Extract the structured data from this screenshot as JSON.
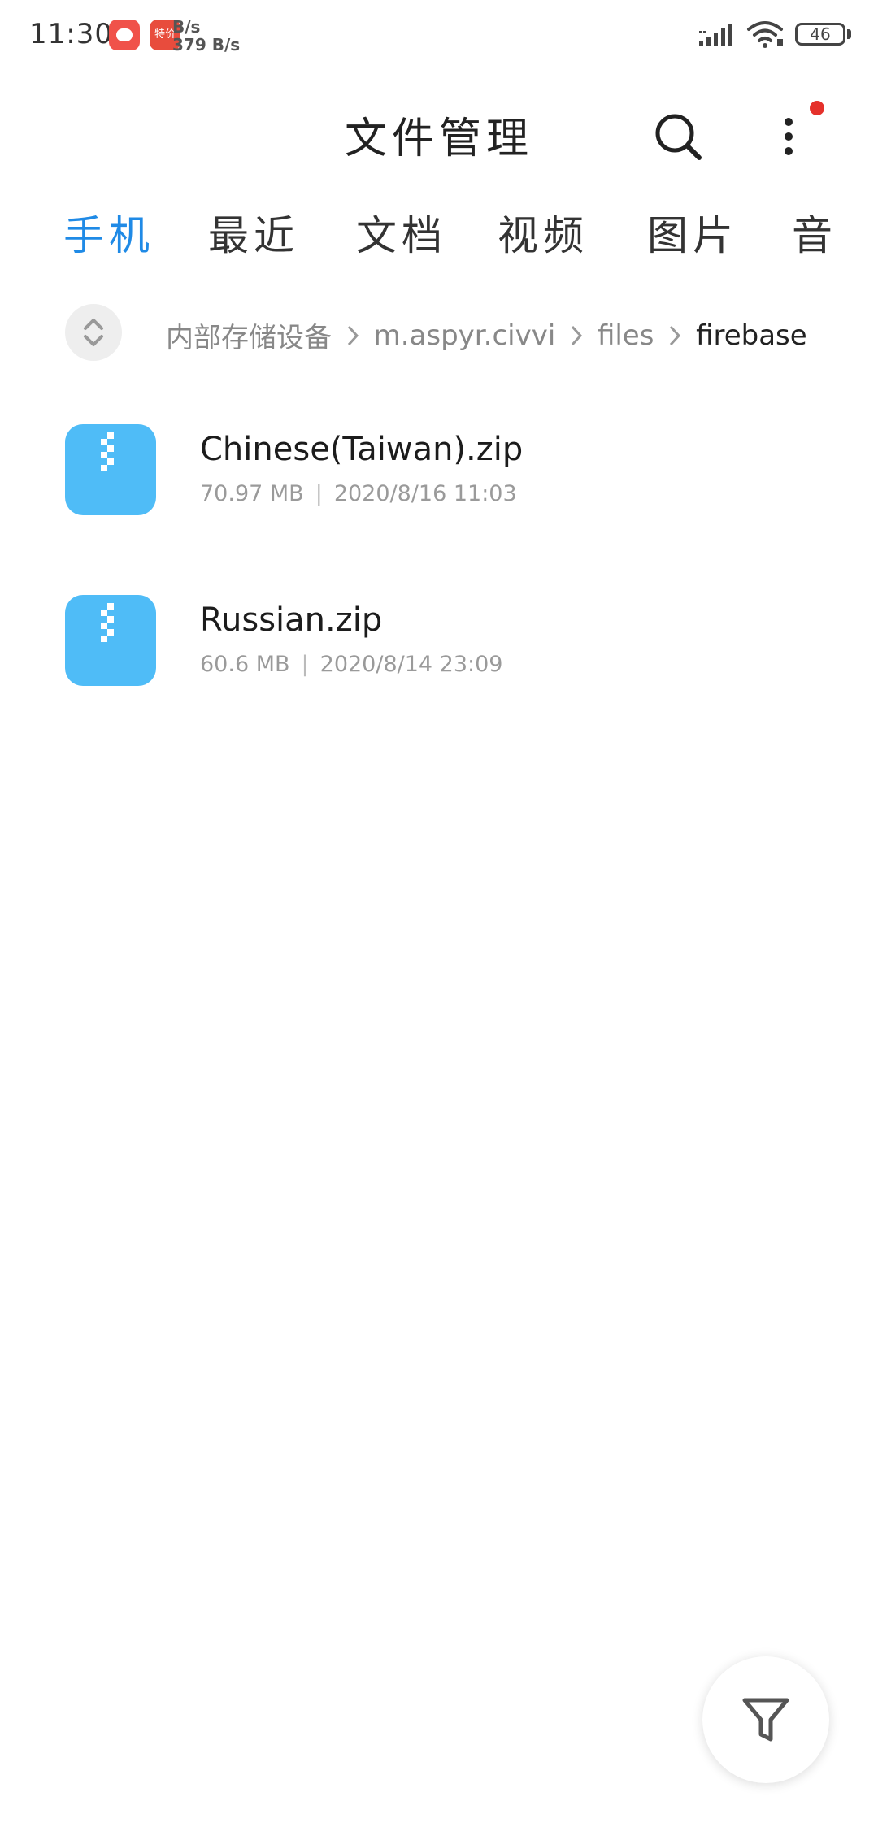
{
  "status_bar": {
    "time": "11:30",
    "app_badge_text": "特价",
    "net_speed_line1": "B/s",
    "net_speed_line2": "379 B/s",
    "battery": "46",
    "icons": [
      "pig-app-icon",
      "sale-app-icon",
      "signal-icon",
      "wifi-icon",
      "battery-icon"
    ]
  },
  "header": {
    "title": "文件管理",
    "search_icon": "search-icon",
    "more_icon": "more-vertical-icon"
  },
  "tabs": [
    {
      "label": "手机",
      "active": true
    },
    {
      "label": "最近",
      "active": false
    },
    {
      "label": "文档",
      "active": false
    },
    {
      "label": "视频",
      "active": false
    },
    {
      "label": "图片",
      "active": false
    },
    {
      "label": "音",
      "active": false
    }
  ],
  "breadcrumb": {
    "sort_icon": "sort-toggle-icon",
    "segments": [
      "内部存储设备",
      "m.aspyr.civvi",
      "files",
      "firebase"
    ]
  },
  "files": [
    {
      "name": "Chinese(Taiwan).zip",
      "size": "70.97 MB",
      "date": "2020/8/16 11:03",
      "icon": "zip-file-icon"
    },
    {
      "name": "Russian.zip",
      "size": "60.6 MB",
      "date": "2020/8/14 23:09",
      "icon": "zip-file-icon"
    }
  ],
  "fab": {
    "icon": "filter-icon"
  },
  "colors": {
    "accent": "#1f8ae6",
    "zip_icon": "#4fbcf7",
    "notification_dot": "#e5312b"
  }
}
